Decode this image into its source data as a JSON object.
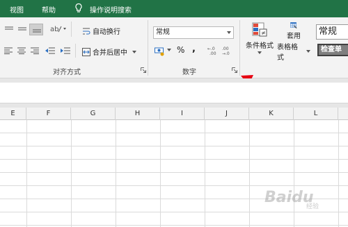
{
  "tabs": [
    {
      "label": "视图"
    },
    {
      "label": "帮助"
    },
    {
      "label": "操作说明搜索"
    }
  ],
  "alignment": {
    "wrap_text": "自动换行",
    "merge_center": "合并后居中",
    "group_label": "对齐方式"
  },
  "number": {
    "format_value": "常规",
    "percent": "%",
    "comma": ",",
    "increase_decimal": "←.0 .00",
    "decrease_decimal": ".00 →.0",
    "group_label": "数字"
  },
  "styles": {
    "conditional_formatting": "条件格式",
    "format_as_table_line1": "套用",
    "format_as_table_line2": "表格格式",
    "cell_style_normal": "常规",
    "cell_style_check": "检查单"
  },
  "columns": [
    "E",
    "F",
    "G",
    "H",
    "I",
    "J",
    "K",
    "L"
  ],
  "watermark": {
    "main": "Baidu",
    "sub": "经验"
  },
  "colors": {
    "title_bar": "#217346",
    "annotation_arrow": "#e60012"
  }
}
